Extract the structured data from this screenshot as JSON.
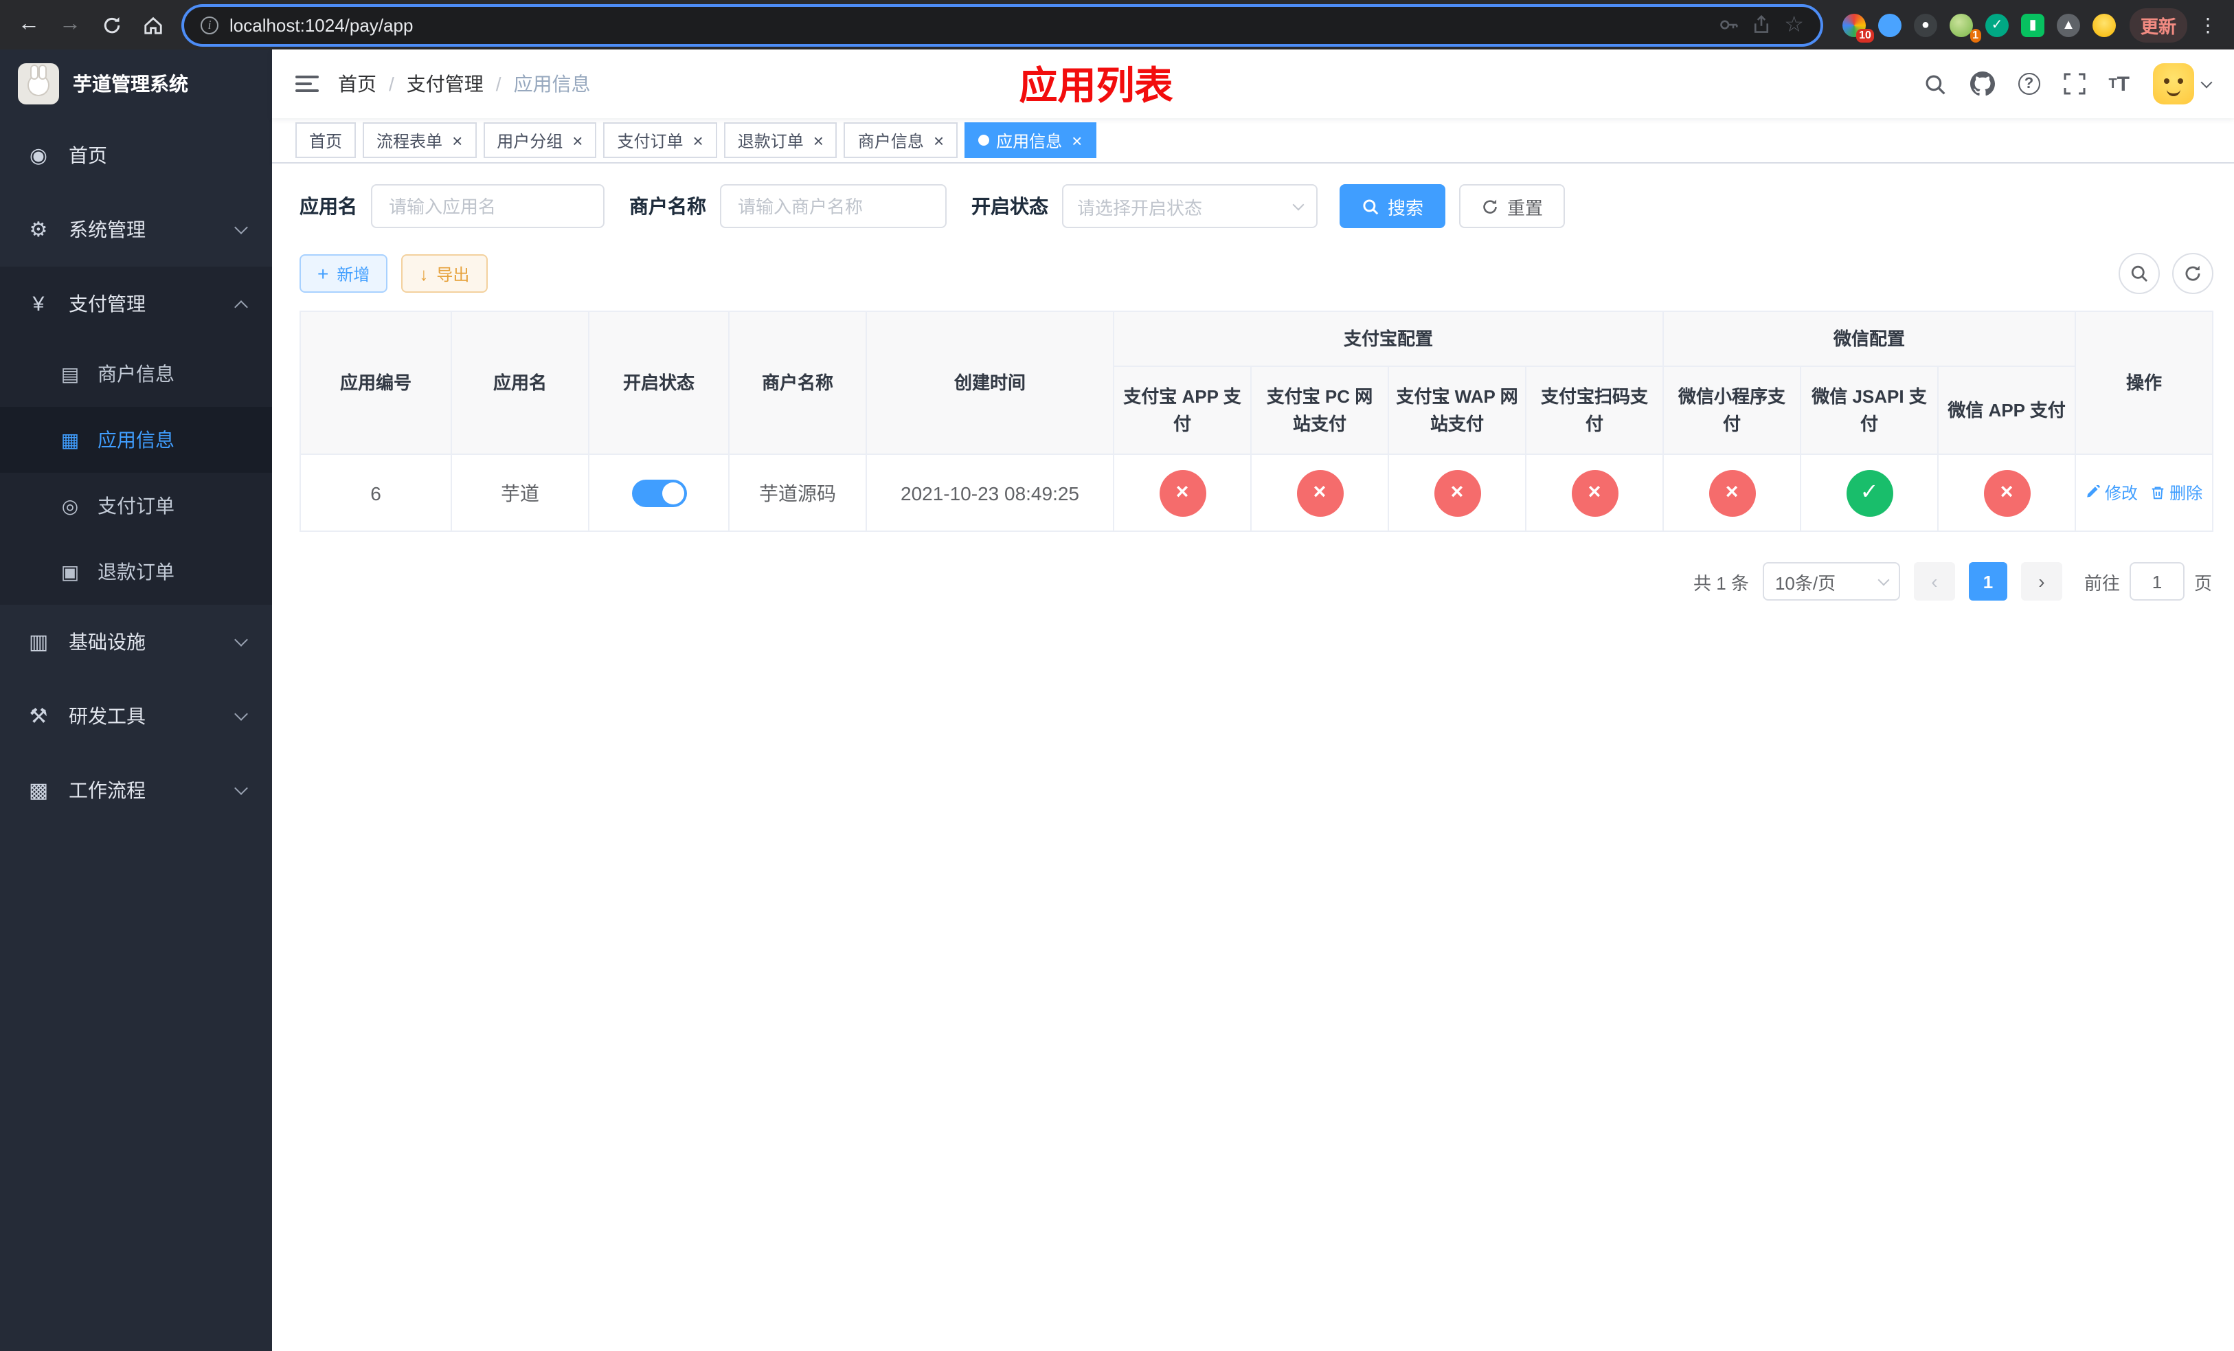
{
  "browser": {
    "url": "localhost:1024/pay/app",
    "update_label": "更新",
    "ext_badge_count": "10",
    "ext_avatar_badge": "1"
  },
  "sidebar": {
    "title": "芋道管理系统",
    "home": "首页",
    "system": "系统管理",
    "payment": "支付管理",
    "sub_merchant": "商户信息",
    "sub_app": "应用信息",
    "sub_order": "支付订单",
    "sub_refund": "退款订单",
    "infra": "基础设施",
    "devtools": "研发工具",
    "workflow": "工作流程"
  },
  "header": {
    "breadcrumb_home": "首页",
    "breadcrumb_payment": "支付管理",
    "breadcrumb_current": "应用信息",
    "page_title": "应用列表"
  },
  "tabs": [
    {
      "label": "首页",
      "closable": false,
      "active": false
    },
    {
      "label": "流程表单",
      "closable": true,
      "active": false
    },
    {
      "label": "用户分组",
      "closable": true,
      "active": false
    },
    {
      "label": "支付订单",
      "closable": true,
      "active": false
    },
    {
      "label": "退款订单",
      "closable": true,
      "active": false
    },
    {
      "label": "商户信息",
      "closable": true,
      "active": false
    },
    {
      "label": "应用信息",
      "closable": true,
      "active": true
    }
  ],
  "filters": {
    "app_name_label": "应用名",
    "app_name_placeholder": "请输入应用名",
    "merchant_label": "商户名称",
    "merchant_placeholder": "请输入商户名称",
    "status_label": "开启状态",
    "status_placeholder": "请选择开启状态",
    "search_label": "搜索",
    "reset_label": "重置"
  },
  "toolbar": {
    "add_label": "新增",
    "export_label": "导出"
  },
  "table": {
    "headers": {
      "app_id": "应用编号",
      "app_name": "应用名",
      "status": "开启状态",
      "merchant": "商户名称",
      "created": "创建时间",
      "alipay_group": "支付宝配置",
      "wechat_group": "微信配置",
      "ops": "操作",
      "alipay_app": "支付宝 APP 支付",
      "alipay_pc": "支付宝 PC 网站支付",
      "alipay_wap": "支付宝 WAP 网站支付",
      "alipay_qr": "支付宝扫码支付",
      "wx_mini": "微信小程序支付",
      "wx_jsapi": "微信 JSAPI 支付",
      "wx_app": "微信 APP 支付"
    },
    "rows": [
      {
        "app_id": "6",
        "app_name": "芋道",
        "status_on": true,
        "merchant": "芋道源码",
        "created": "2021-10-23 08:49:25",
        "flags": {
          "alipay_app": false,
          "alipay_pc": false,
          "alipay_wap": false,
          "alipay_qr": false,
          "wx_mini": false,
          "wx_jsapi": true,
          "wx_app": false
        },
        "edit_label": "修改",
        "delete_label": "删除"
      }
    ]
  },
  "pagination": {
    "total_text": "共 1 条",
    "page_size_text": "10条/页",
    "prev_symbol": "‹",
    "next_symbol": "›",
    "current_page": "1",
    "goto_prefix": "前往",
    "goto_value": "1",
    "goto_suffix": "页"
  }
}
